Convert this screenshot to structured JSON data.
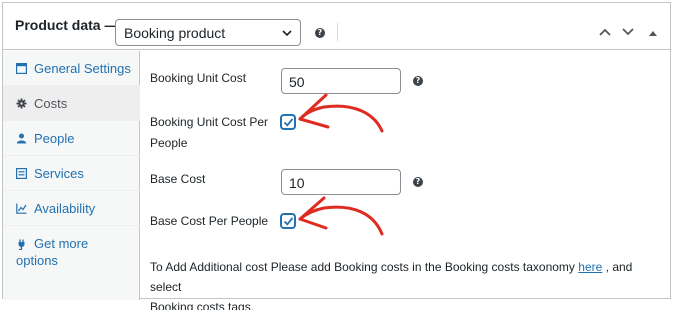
{
  "header": {
    "title": "Product data —",
    "product_type": "Booking product"
  },
  "sidebar": {
    "items": [
      {
        "label": "General Settings",
        "icon": "wrench-window-icon",
        "active": false
      },
      {
        "label": "Costs",
        "icon": "gear-icon",
        "active": true
      },
      {
        "label": "People",
        "icon": "person-icon",
        "active": false
      },
      {
        "label": "Services",
        "icon": "list-icon",
        "active": false
      },
      {
        "label": "Availability",
        "icon": "chart-icon",
        "active": false
      },
      {
        "label": "Get more",
        "label_line2": "options",
        "icon": "plug-icon",
        "active": false
      }
    ]
  },
  "costs": {
    "unit_cost_label": "Booking Unit Cost",
    "unit_cost_value": "50",
    "unit_cost_per_people_label_1": "Booking Unit Cost Per",
    "unit_cost_per_people_label_2": "People",
    "unit_cost_per_people_checked": true,
    "base_cost_label": "Base Cost",
    "base_cost_value": "10",
    "base_cost_per_people_label": "Base Cost Per People",
    "base_cost_per_people_checked": true,
    "info_text_before": "To Add Additional cost Please add Booking costs in the Booking costs taxonomy",
    "info_link": "here",
    "info_text_after": ", and select",
    "info_text_line2": "Booking costs tags."
  },
  "colors": {
    "link": "#2271b1",
    "annotation": "#e02b20"
  }
}
